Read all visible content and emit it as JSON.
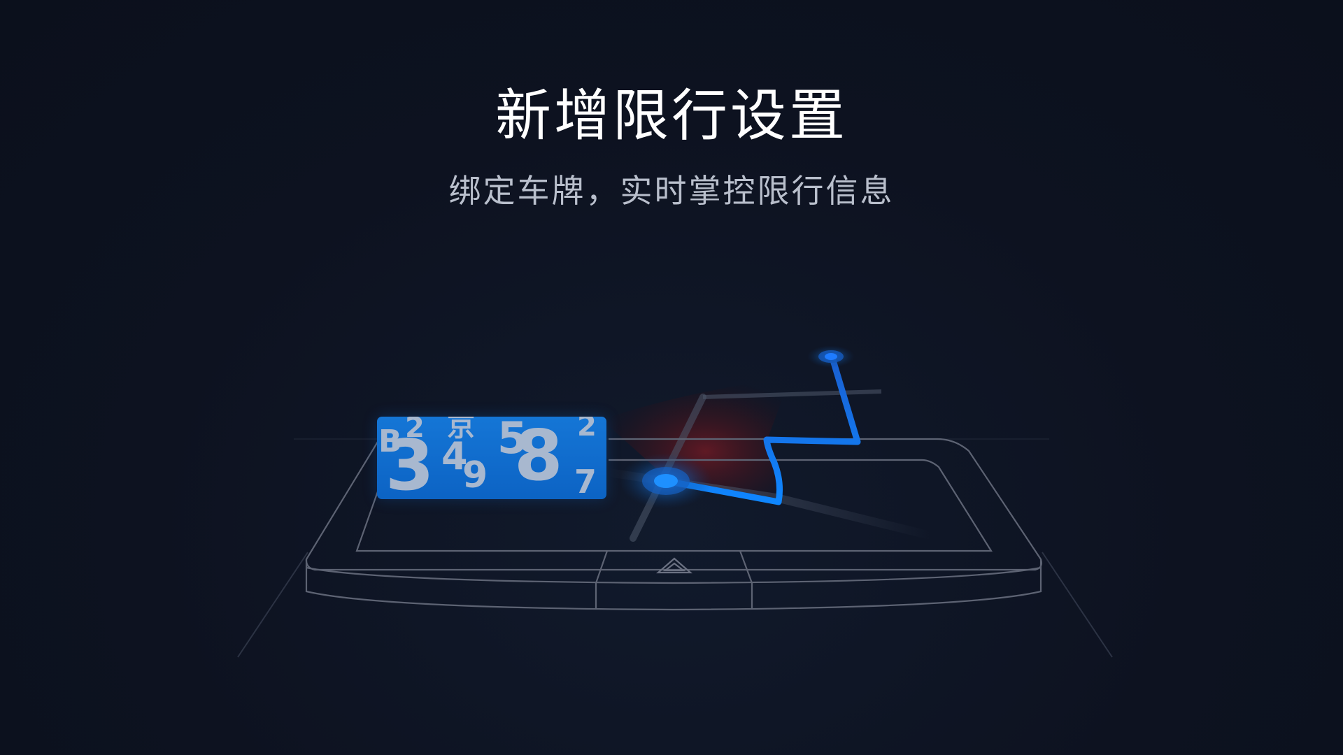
{
  "header": {
    "title": "新增限行设置",
    "subtitle": "绑定车牌，实时掌控限行信息"
  },
  "plate": {
    "chars": [
      "B",
      "2",
      "3",
      "4",
      "京",
      "9",
      "5",
      "8",
      "2",
      "7"
    ]
  },
  "colors": {
    "background": "#0d1220",
    "route_blue": "#0f86ff",
    "plate_blue": "#1576d6",
    "outline_gray": "#5d6373",
    "restricted_red": "#6b1820"
  },
  "icons": {
    "warning": "hazard-triangle-icon",
    "location": "location-pin-icon",
    "destination": "destination-dot-icon"
  }
}
